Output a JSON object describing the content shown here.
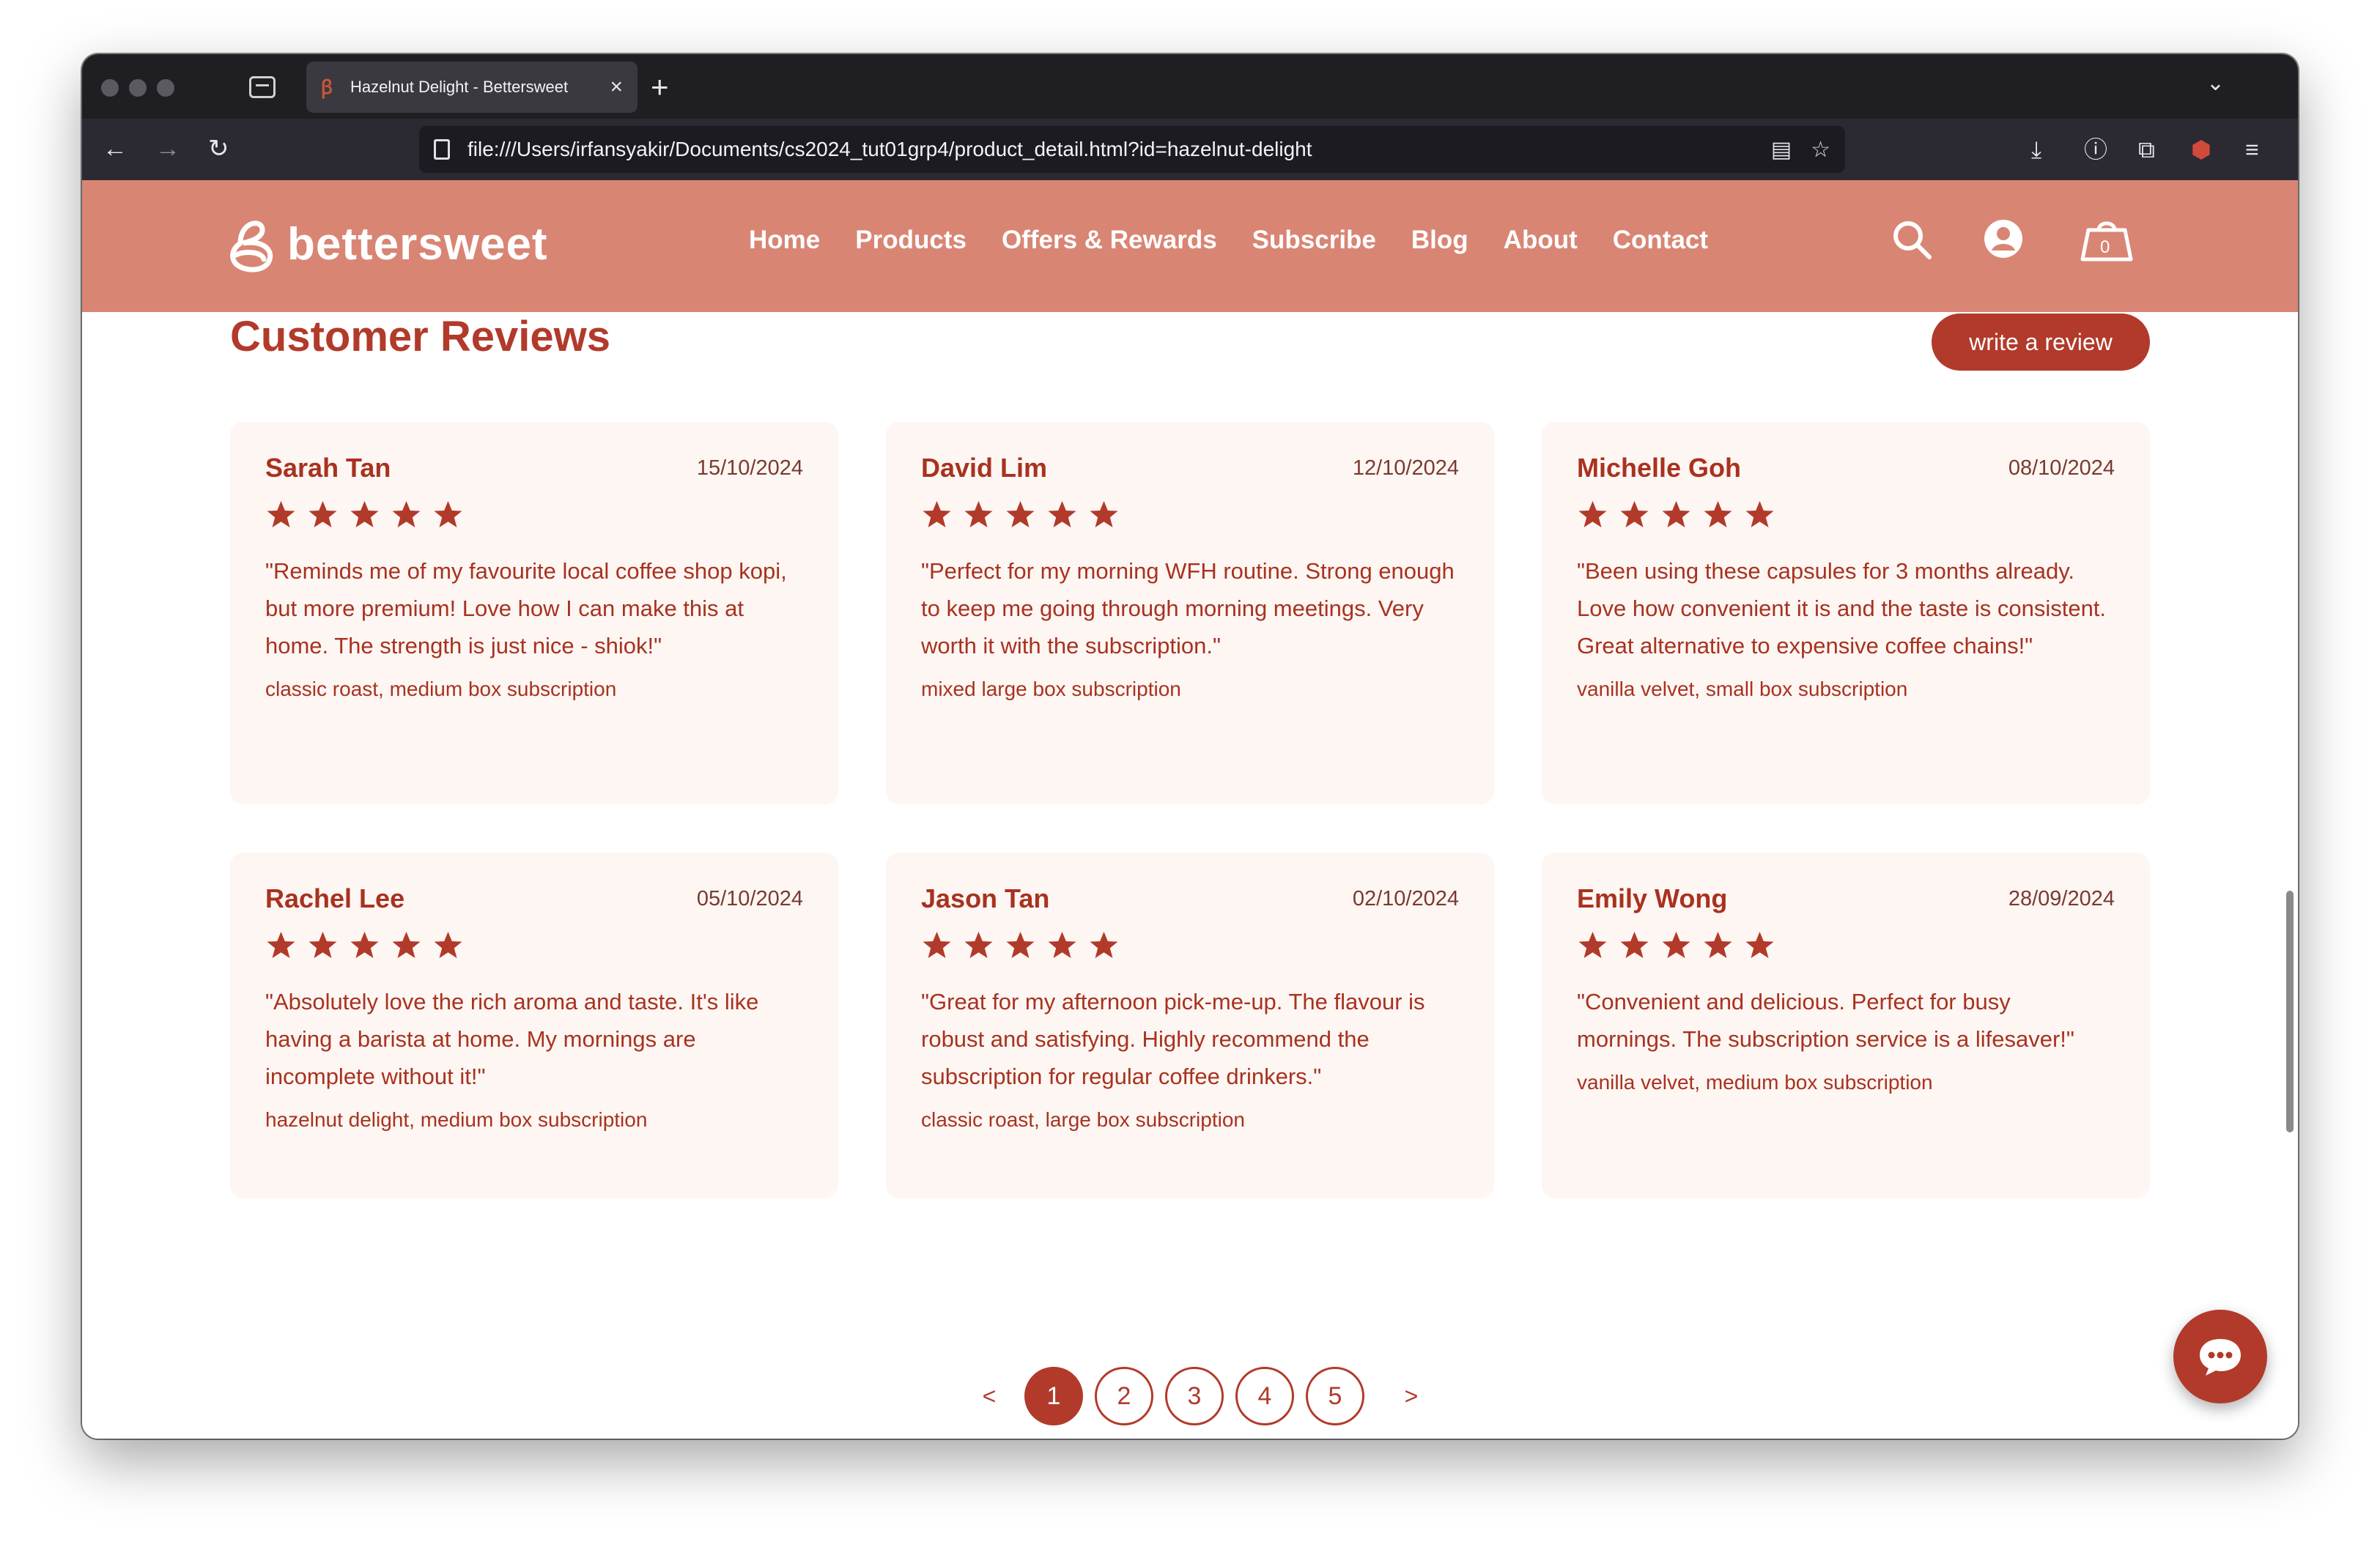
{
  "browser": {
    "tab_title": "Hazelnut Delight - Bettersweet",
    "url": "file:///Users/irfansyakir/Documents/cs2024_tut01grp4/product_detail.html?id=hazelnut-delight"
  },
  "site": {
    "logo_text": "bettersweet",
    "nav": [
      "Home",
      "Products",
      "Offers & Rewards",
      "Subscribe",
      "Blog",
      "About",
      "Contact"
    ],
    "cart_count": "0"
  },
  "reviews": {
    "title": "Customer Reviews",
    "write_label": "write a review",
    "items": [
      {
        "name": "Sarah Tan",
        "date": "15/10/2024",
        "rating": 5,
        "text": "\"Reminds me of my favourite local coffee shop kopi, but more premium! Love how I can make this at home. The strength is just nice - shiok!\"",
        "product": "classic roast, medium box subscription"
      },
      {
        "name": "David Lim",
        "date": "12/10/2024",
        "rating": 5,
        "text": "\"Perfect for my morning WFH routine. Strong enough to keep me going through morning meetings. Very worth it with the subscription.\"",
        "product": "mixed large box subscription"
      },
      {
        "name": "Michelle Goh",
        "date": "08/10/2024",
        "rating": 5,
        "text": "\"Been using these capsules for 3 months already. Love how convenient it is and the taste is consistent. Great alternative to expensive coffee chains!\"",
        "product": "vanilla velvet, small box subscription"
      },
      {
        "name": "Rachel Lee",
        "date": "05/10/2024",
        "rating": 5,
        "text": "\"Absolutely love the rich aroma and taste. It's like having a barista at home. My mornings are incomplete without it!\"",
        "product": "hazelnut delight, medium box subscription"
      },
      {
        "name": "Jason Tan",
        "date": "02/10/2024",
        "rating": 5,
        "text": "\"Great for my afternoon pick-me-up. The flavour is robust and satisfying. Highly recommend the subscription for regular coffee drinkers.\"",
        "product": "classic roast, large box subscription"
      },
      {
        "name": "Emily Wong",
        "date": "28/09/2024",
        "rating": 5,
        "text": "\"Convenient and delicious. Perfect for busy mornings. The subscription service is a lifesaver!\"",
        "product": "vanilla velvet, medium box subscription"
      }
    ]
  },
  "pagination": {
    "prev": "<",
    "next": ">",
    "pages": [
      "1",
      "2",
      "3",
      "4",
      "5"
    ],
    "current": "1"
  },
  "colors": {
    "header_bg": "#d98574",
    "accent": "#b23a2a",
    "card_bg": "#fdf6f3"
  }
}
